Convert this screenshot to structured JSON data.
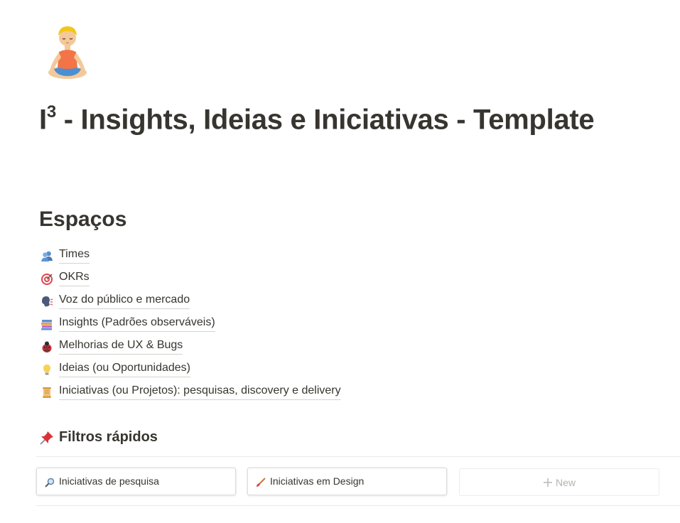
{
  "page": {
    "icon": "meditating-person-icon",
    "title_main": "I",
    "title_sup": "3",
    "title_rest": " - Insights, Ideias e Iniciativas - Template"
  },
  "spaces": {
    "heading": "Espaços",
    "items": [
      {
        "icon": "busts-icon",
        "label": "Times"
      },
      {
        "icon": "target-icon",
        "label": "OKRs"
      },
      {
        "icon": "speaking-head-icon",
        "label": "Voz do público e mercado"
      },
      {
        "icon": "books-icon",
        "label": "Insights (Padrões observáveis)"
      },
      {
        "icon": "ladybug-icon",
        "label": "Melhorias de UX & Bugs"
      },
      {
        "icon": "lightbulb-icon",
        "label": "Ideias (ou Oportunidades)"
      },
      {
        "icon": "scroll-icon",
        "label": "Iniciativas (ou Projetos): pesquisas, discovery e delivery"
      }
    ]
  },
  "filters": {
    "heading": "Filtros rápidos",
    "heading_icon": "pushpin-icon",
    "cards": [
      {
        "icon": "magnifier-icon",
        "label": "Iniciativas de pesquisa"
      },
      {
        "icon": "paintbrush-icon",
        "label": "Iniciativas em Design"
      }
    ],
    "new_label": "New"
  }
}
